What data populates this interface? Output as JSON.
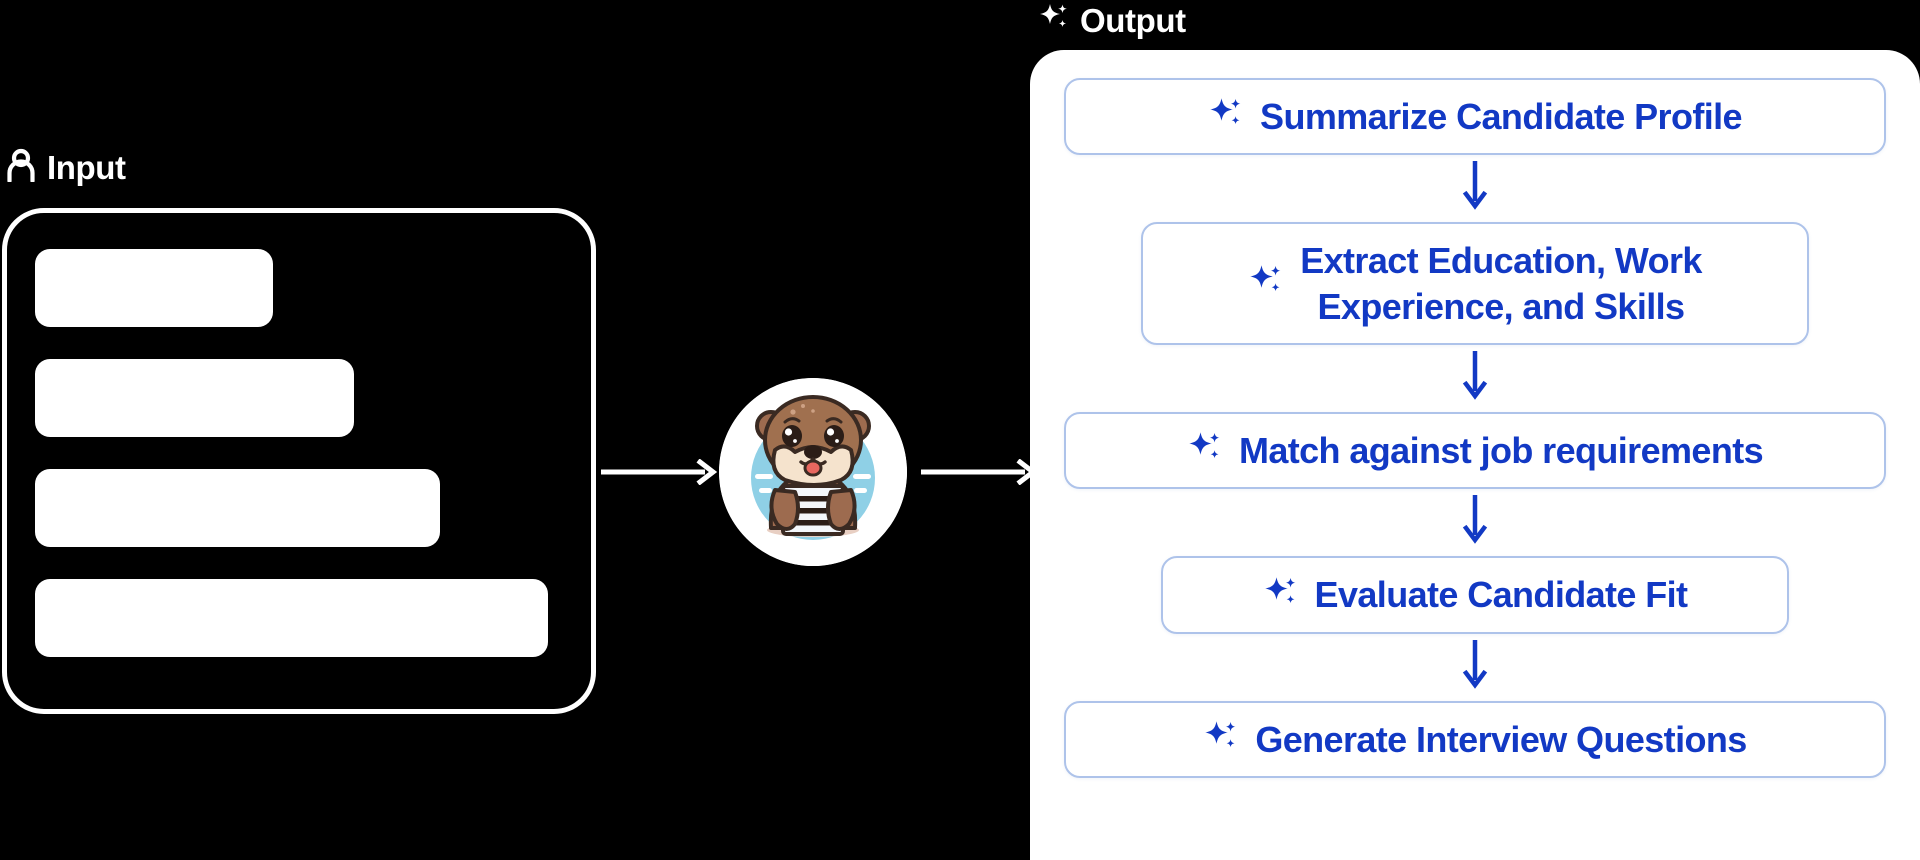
{
  "colors": {
    "background": "#000000",
    "panel": "#ffffff",
    "accent_blue": "#1239c4",
    "box_border": "#aec3ea",
    "arrow_white": "#ffffff",
    "otter_fur": "#9d6b4f",
    "otter_muzzle": "#f5e3cd",
    "otter_bg_circle": "#8fd0e6"
  },
  "input": {
    "icon": "person-icon",
    "label": "Input",
    "placeholder_bars": [
      {
        "id": "bar-1",
        "width_pct": 44
      },
      {
        "id": "bar-2",
        "width_pct": 59
      },
      {
        "id": "bar-3",
        "width_pct": 75
      },
      {
        "id": "bar-4",
        "width_pct": 95
      }
    ]
  },
  "arrows": {
    "input_to_agent": "arrow-right",
    "agent_to_output": "arrow-right",
    "step_connector": "arrow-down"
  },
  "agent": {
    "icon": "otter-mascot-icon",
    "description": "otter holding document"
  },
  "output": {
    "icon": "sparkles-icon",
    "label": "Output",
    "steps": [
      {
        "id": "step-1",
        "icon": "sparkles-icon",
        "label": "Summarize Candidate Profile",
        "width": "full"
      },
      {
        "id": "step-2",
        "icon": "sparkles-icon",
        "label": "Extract Education, Work\nExperience, and Skills",
        "width": "w2"
      },
      {
        "id": "step-3",
        "icon": "sparkles-icon",
        "label": "Match against job requirements",
        "width": "full"
      },
      {
        "id": "step-4",
        "icon": "sparkles-icon",
        "label": "Evaluate Candidate Fit",
        "width": "w4"
      },
      {
        "id": "step-5",
        "icon": "sparkles-icon",
        "label": "Generate Interview Questions",
        "width": "full"
      }
    ]
  }
}
